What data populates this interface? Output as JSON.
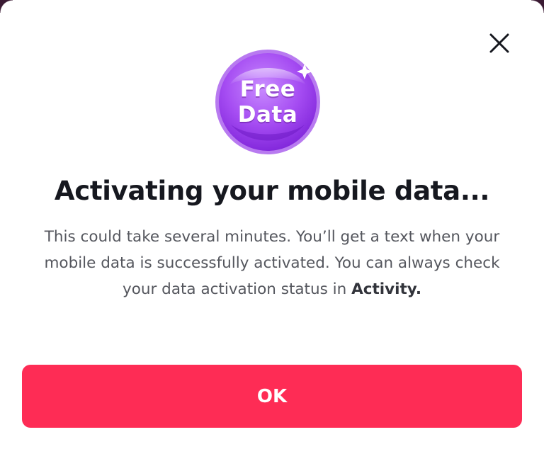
{
  "dialog": {
    "badge": {
      "line1": "Free",
      "line2": "Data",
      "icon": "free-data-badge-icon"
    },
    "title": "Activating your mobile data...",
    "message": {
      "text": "This could take several minutes. You’ll get a text when your mobile data is successfully activated. You can always check your data activation status in ",
      "emphasis": "Activity."
    },
    "close_icon": "close-icon",
    "ok_label": "OK"
  },
  "colors": {
    "primary_button": "#fe2c55",
    "badge_purple": "#a84ef0",
    "title_text": "#16181f",
    "body_text": "#54565d"
  }
}
